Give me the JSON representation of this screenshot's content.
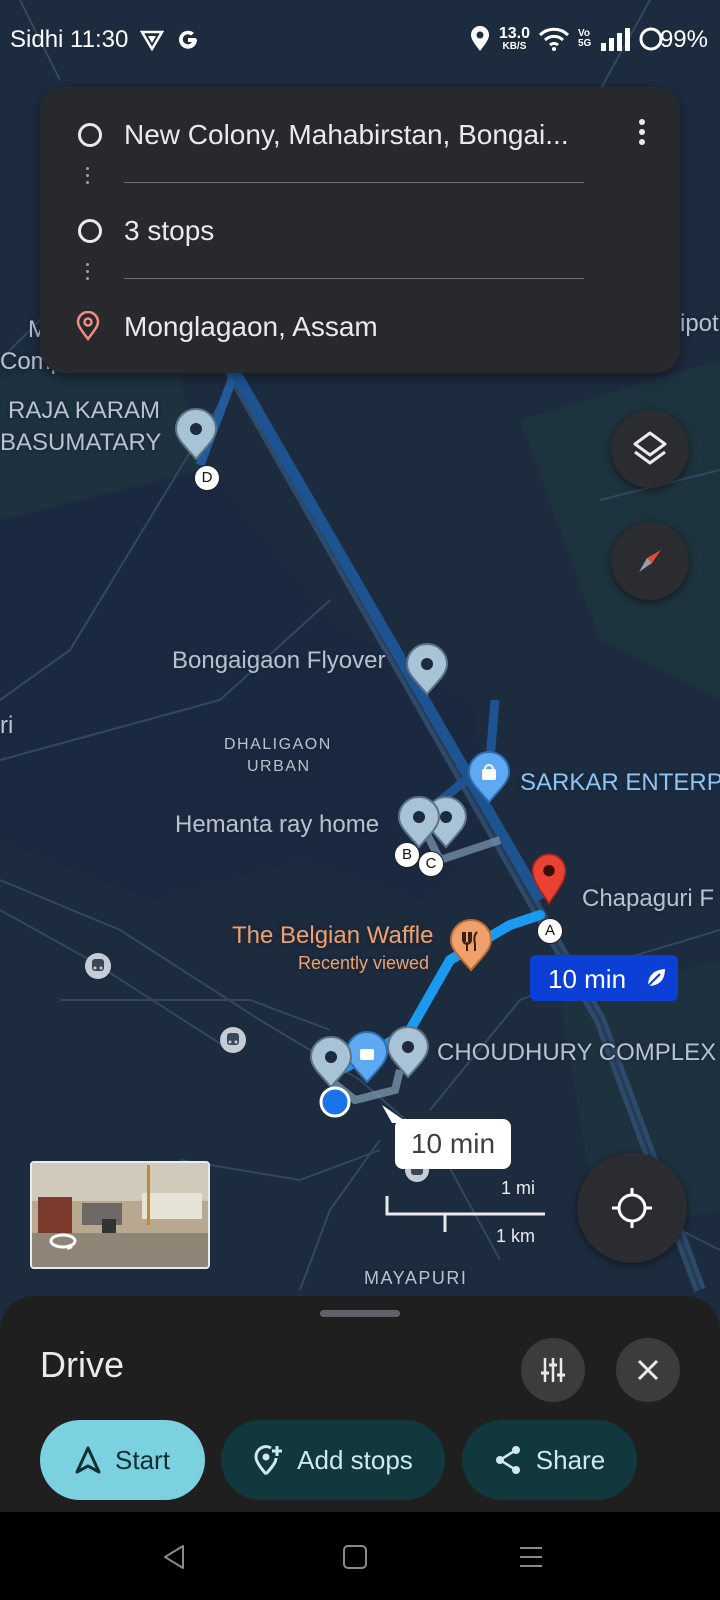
{
  "status_bar": {
    "time": "Sidhi 11:30",
    "data_speed_value": "13.0",
    "data_speed_unit": "KB/S",
    "network_label": "Vo 5G",
    "battery": "99%"
  },
  "route_card": {
    "origin": "New Colony, Mahabirstan, Bongai...",
    "stops": "3 stops",
    "destination": "Monglagaon, Assam"
  },
  "map": {
    "labels": {
      "raja_line1": "RAJA KARAM",
      "raja_line2": "BASUMATARY",
      "flyover": "Bongaigaon Flyover",
      "dhaligaon_line1": "DHALIGAON",
      "dhaligaon_line2": "URBAN",
      "sarkar": "SARKAR ENTERP",
      "hemanta": "Hemanta ray home",
      "chapaguri": "Chapaguri F",
      "waffle": "The Belgian Waffle",
      "recently_viewed": "Recently viewed",
      "choudhury": "CHOUDHURY COMPLEX",
      "mayapuri": "MAYAPURI",
      "edge_ipot": "ipot",
      "edge_m": "M",
      "edge_comp": "Comp",
      "edge_ri": "ri"
    },
    "stop_letters": {
      "a": "A",
      "b": "B",
      "c": "C",
      "d": "D"
    },
    "duration_primary": "10 min",
    "duration_alt": "10 min",
    "scale": {
      "miles": "1 mi",
      "km": "1 km"
    }
  },
  "bottom_sheet": {
    "title": "Drive",
    "start_label": "Start",
    "add_stops_label": "Add stops",
    "share_label": "Share"
  },
  "colors": {
    "route_primary": "#1a9bf0",
    "route_alt": "#235a9a",
    "accent_start": "#7cd1e0",
    "pin_red": "#e84235"
  },
  "icons": [
    "menu-more-icon",
    "layers-icon",
    "compass-icon",
    "my-location-icon",
    "tune-icon",
    "close-icon",
    "navigation-arrow-icon",
    "add-location-icon",
    "share-icon",
    "eco-leaf-icon"
  ]
}
